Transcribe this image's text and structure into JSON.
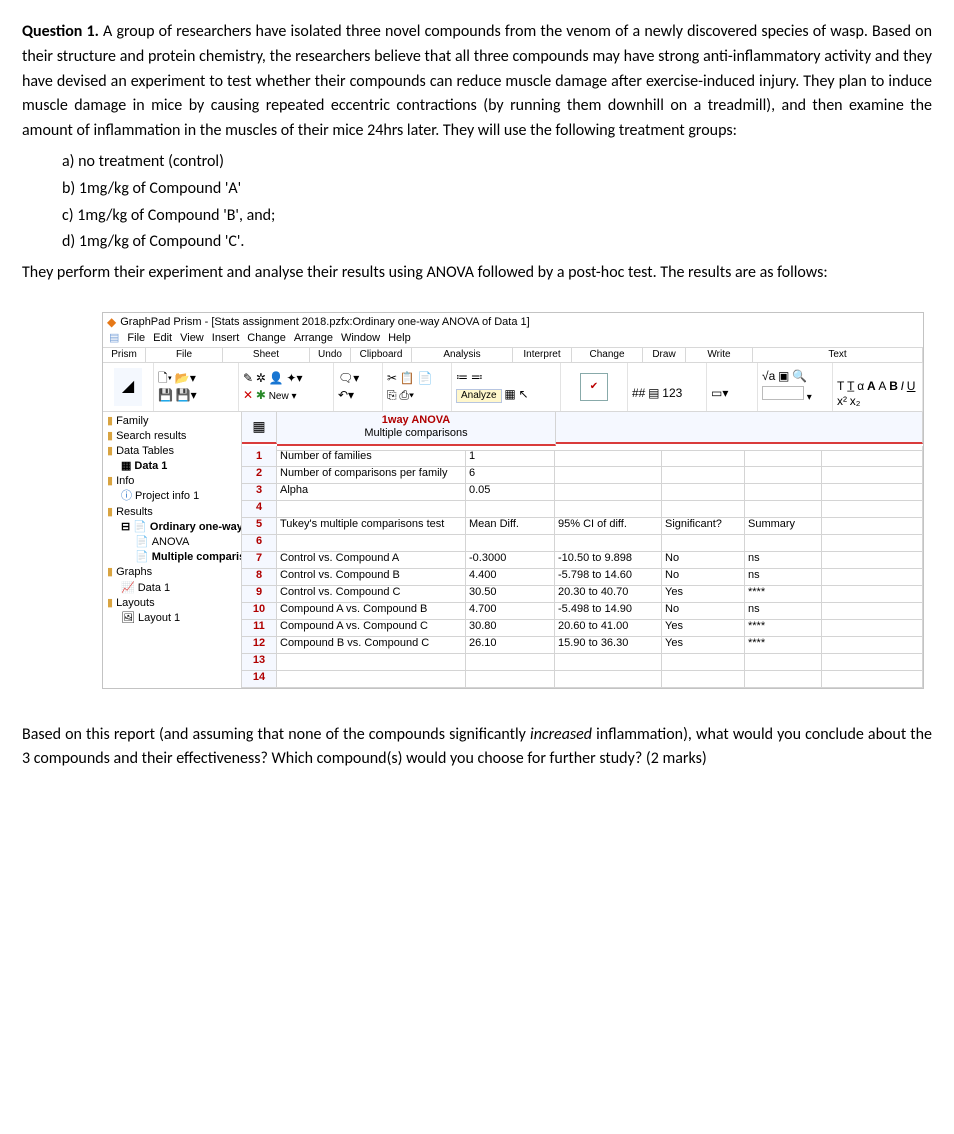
{
  "question": {
    "label": "Question 1.",
    "intro": " A group of researchers have isolated three novel compounds from the venom of a newly discovered species of wasp. Based on their structure and protein chemistry, the researchers believe that all three compounds may have strong anti-inflammatory activity and they have devised an experiment to test whether their compounds can reduce muscle damage after exercise-induced injury. They plan to induce muscle damage in mice by causing repeated eccentric contractions (by running them downhill on a treadmill), and then examine the amount of inflammation in the muscles of their mice 24hrs later. They will use the following treatment groups:",
    "treatments": {
      "a": "a)   no treatment (control)",
      "b": "b)   1mg/kg of Compound 'A'",
      "c": "c)   1mg/kg of Compound 'B', and;",
      "d": "d)   1mg/kg of Compound 'C'."
    },
    "mid": "They perform their experiment and analyse their results using ANOVA followed by a post-hoc test. The results are as follows:",
    "conclusion_pre": "Based on this report (and assuming that none of the compounds significantly ",
    "conclusion_emph": "increased",
    "conclusion_post": " inflammation), what would you conclude about the 3 compounds and their effectiveness? Which compound(s) would you choose for further study? (2 marks)"
  },
  "app": {
    "title": "GraphPad Prism - [Stats assignment 2018.pzfx:Ordinary one-way ANOVA of Data 1]",
    "menus": [
      "File",
      "Edit",
      "View",
      "Insert",
      "Change",
      "Arrange",
      "Window",
      "Help"
    ],
    "groups": [
      "Prism",
      "File",
      "Sheet",
      "Undo",
      "Clipboard",
      "Analysis",
      "Interpret",
      "Change",
      "Draw",
      "Write",
      "Text"
    ],
    "tools": {
      "new": "New ▾",
      "analyze": "Analyze"
    },
    "sidebar": {
      "family": "Family",
      "search": "Search results",
      "datatables": "Data Tables",
      "data1": "Data 1",
      "info": "Info",
      "projinfo": "Project info 1",
      "results": "Results",
      "owanova": "Ordinary one-way ANOVA o",
      "anova": "ANOVA",
      "multcomp": "Multiple comparisons",
      "graphs": "Graphs",
      "gdata1": "Data 1",
      "layouts": "Layouts",
      "layout1": "Layout 1"
    },
    "grid": {
      "header_title": "1way ANOVA",
      "header_sub": "Multiple comparisons",
      "rows": [
        {
          "n": "1",
          "a": "Number of families",
          "b": "1",
          "c": "",
          "d": "",
          "e": "",
          "f": ""
        },
        {
          "n": "2",
          "a": "Number of comparisons per family",
          "b": "6",
          "c": "",
          "d": "",
          "e": "",
          "f": ""
        },
        {
          "n": "3",
          "a": "Alpha",
          "b": "0.05",
          "c": "",
          "d": "",
          "e": "",
          "f": ""
        },
        {
          "n": "4",
          "a": "",
          "b": "",
          "c": "",
          "d": "",
          "e": "",
          "f": ""
        },
        {
          "n": "5",
          "a": "Tukey's multiple comparisons test",
          "b": "Mean Diff.",
          "c": "95% CI of diff.",
          "d": "Significant?",
          "e": "Summary",
          "f": ""
        },
        {
          "n": "6",
          "a": "",
          "b": "",
          "c": "",
          "d": "",
          "e": "",
          "f": ""
        },
        {
          "n": "7",
          "a": "  Control vs. Compound A",
          "b": "-0.3000",
          "c": "-10.50 to 9.898",
          "d": "No",
          "e": "ns",
          "f": ""
        },
        {
          "n": "8",
          "a": "  Control vs. Compound B",
          "b": "4.400",
          "c": "-5.798 to 14.60",
          "d": "No",
          "e": "ns",
          "f": ""
        },
        {
          "n": "9",
          "a": "  Control vs. Compound C",
          "b": "30.50",
          "c": "20.30 to 40.70",
          "d": "Yes",
          "e": "****",
          "f": ""
        },
        {
          "n": "10",
          "a": "  Compound A vs. Compound B",
          "b": "4.700",
          "c": "-5.498 to 14.90",
          "d": "No",
          "e": "ns",
          "f": ""
        },
        {
          "n": "11",
          "a": "  Compound A vs. Compound C",
          "b": "30.80",
          "c": "20.60 to 41.00",
          "d": "Yes",
          "e": "****",
          "f": ""
        },
        {
          "n": "12",
          "a": "  Compound B vs. Compound C",
          "b": "26.10",
          "c": "15.90 to 36.30",
          "d": "Yes",
          "e": "****",
          "f": ""
        },
        {
          "n": "13",
          "a": "",
          "b": "",
          "c": "",
          "d": "",
          "e": "",
          "f": ""
        },
        {
          "n": "14",
          "a": "",
          "b": "",
          "c": "",
          "d": "",
          "e": "",
          "f": ""
        }
      ]
    }
  }
}
